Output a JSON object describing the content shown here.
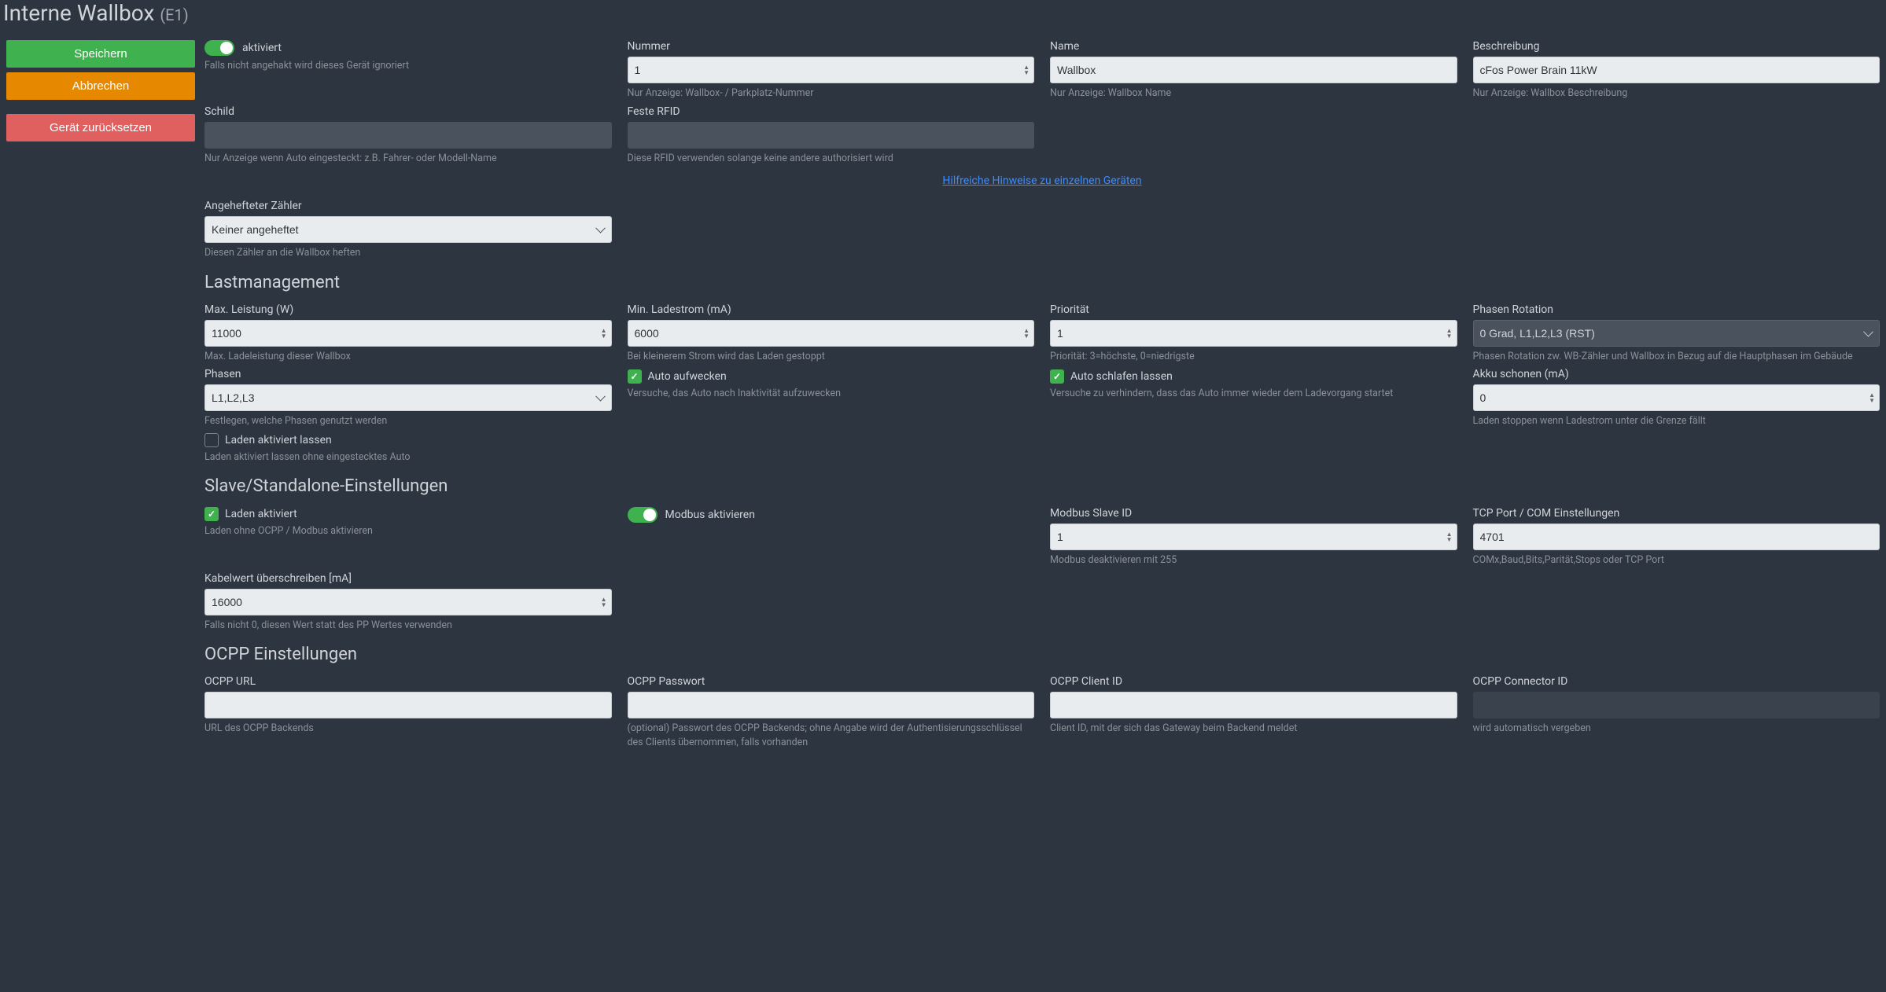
{
  "header": {
    "title": "Interne Wallbox",
    "suffix": "(E1)"
  },
  "sidebar": {
    "save": "Speichern",
    "cancel": "Abbrechen",
    "reset": "Gerät zurücksetzen"
  },
  "top": {
    "activated": {
      "label": "aktiviert",
      "help": "Falls nicht angehakt wird dieses Gerät ignoriert"
    },
    "number": {
      "label": "Nummer",
      "value": "1",
      "help": "Nur Anzeige: Wallbox- / Parkplatz-Nummer"
    },
    "name": {
      "label": "Name",
      "value": "Wallbox",
      "help": "Nur Anzeige: Wallbox Name"
    },
    "description": {
      "label": "Beschreibung",
      "value": "cFos Power Brain 11kW",
      "help": "Nur Anzeige: Wallbox Beschreibung"
    },
    "sign": {
      "label": "Schild",
      "value": "",
      "help": "Nur Anzeige wenn Auto eingesteckt: z.B. Fahrer- oder Modell-Name"
    },
    "fixedRfid": {
      "label": "Feste RFID",
      "value": "",
      "help": "Diese RFID verwenden solange keine andere authorisiert wird"
    },
    "helpLink": "Hilfreiche Hinweise zu einzelnen Geräten",
    "attachedMeter": {
      "label": "Angehefteter Zähler",
      "value": "Keiner angeheftet",
      "help": "Diesen Zähler an die Wallbox heften"
    }
  },
  "loadMgmt": {
    "title": "Lastmanagement",
    "maxPower": {
      "label": "Max. Leistung (W)",
      "value": "11000",
      "help": "Max. Ladeleistung dieser Wallbox"
    },
    "minCurrent": {
      "label": "Min. Ladestrom (mA)",
      "value": "6000",
      "help": "Bei kleinerem Strom wird das Laden gestoppt"
    },
    "priority": {
      "label": "Priorität",
      "value": "1",
      "help": "Priorität: 3=höchste, 0=niedrigste"
    },
    "phaseRotation": {
      "label": "Phasen Rotation",
      "value": "0 Grad, L1,L2,L3 (RST)",
      "help": "Phasen Rotation zw. WB-Zähler und Wallbox in Bezug auf die Hauptphasen im Gebäude"
    },
    "phases": {
      "label": "Phasen",
      "value": "L1,L2,L3",
      "help": "Festlegen, welche Phasen genutzt werden"
    },
    "autoWake": {
      "label": "Auto aufwecken",
      "help": "Versuche, das Auto nach Inaktivität aufzuwecken"
    },
    "autoSleep": {
      "label": "Auto schlafen lassen",
      "help": "Versuche zu verhindern, dass das Auto immer wieder dem Ladevorgang startet"
    },
    "battery": {
      "label": "Akku schonen (mA)",
      "value": "0",
      "help": "Laden stoppen wenn Ladestrom unter die Grenze fällt"
    },
    "keepCharging": {
      "label": "Laden aktiviert lassen",
      "help": "Laden aktiviert lassen ohne eingestecktes Auto"
    }
  },
  "slave": {
    "title": "Slave/Standalone-Einstellungen",
    "chargingEnabled": {
      "label": "Laden aktiviert",
      "help": "Laden ohne OCPP / Modbus aktivieren"
    },
    "modbusEnable": {
      "label": "Modbus aktivieren"
    },
    "modbusSlaveId": {
      "label": "Modbus Slave ID",
      "value": "1",
      "help": "Modbus deaktivieren mit 255"
    },
    "tcpPort": {
      "label": "TCP Port / COM Einstellungen",
      "value": "4701",
      "help": "COMx,Baud,Bits,Parität,Stops oder TCP Port"
    },
    "cableOverride": {
      "label": "Kabelwert überschreiben [mA]",
      "value": "16000",
      "help": "Falls nicht 0, diesen Wert statt des PP Wertes verwenden"
    }
  },
  "ocpp": {
    "title": "OCPP Einstellungen",
    "url": {
      "label": "OCPP URL",
      "value": "",
      "help": "URL des OCPP Backends"
    },
    "password": {
      "label": "OCPP Passwort",
      "value": "",
      "help": "(optional) Passwort des OCPP Backends; ohne Angabe wird der Authentisierungsschlüssel des Clients übernommen, falls vorhanden"
    },
    "clientId": {
      "label": "OCPP Client ID",
      "value": "",
      "help": "Client ID, mit der sich das Gateway beim Backend meldet"
    },
    "connectorId": {
      "label": "OCPP Connector ID",
      "value": "",
      "help": "wird automatisch vergeben"
    }
  }
}
